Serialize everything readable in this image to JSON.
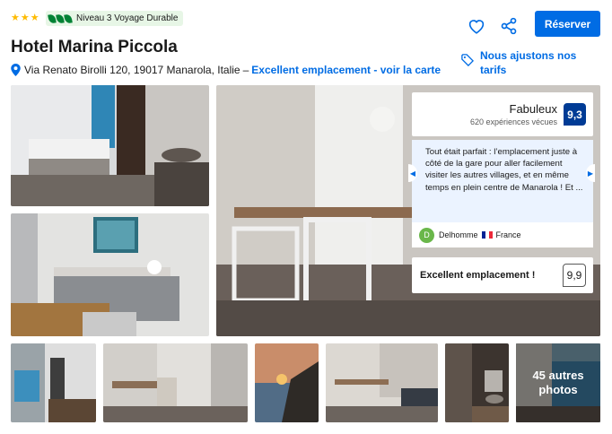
{
  "header": {
    "stars": 3,
    "sustainability_badge": "Niveau 3 Voyage Durable",
    "hotel_name": "Hotel Marina Piccola",
    "address": "Via Renato Birolli 120, 19017 Manarola, Italie",
    "address_separator": "–",
    "map_link": "Excellent emplacement - voir la carte"
  },
  "actions": {
    "reserve_label": "Réserver",
    "price_match_label": "Nous ajustons nos tarifs"
  },
  "review": {
    "rating_word": "Fabuleux",
    "reviews_count": "620 expériences vécues",
    "score": "9,3",
    "quote": "Tout était parfait : l’emplacement juste à côté de la gare pour aller facilement visiter les autres villages, et en même temps en plein centre de Manarola ! Et ...",
    "reviewer_initial": "D",
    "reviewer_name": "Delhomme",
    "reviewer_country": "France",
    "location_label": "Excellent emplacement !",
    "location_score": "9,9"
  },
  "gallery": {
    "more_photos": "45 autres photos"
  },
  "colors": {
    "brand_blue": "#006ce4",
    "score_blue": "#003b95",
    "star_yellow": "#febb02",
    "eco_green": "#008234",
    "quote_bg": "#ebf3ff"
  },
  "icons": [
    "star-icon",
    "leaf-icon",
    "map-pin-icon",
    "heart-icon",
    "share-icon",
    "price-tag-icon",
    "chevron-left-icon",
    "chevron-right-icon",
    "flag-icon"
  ]
}
